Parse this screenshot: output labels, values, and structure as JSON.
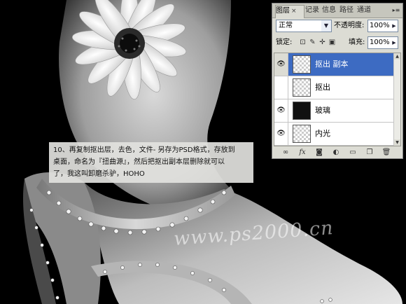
{
  "caption": {
    "lines": [
      "10、再复制抠出层，去色，文件- 另存为PSD格式，存放到",
      "桌面，命名为『扭曲源』，然后把抠出副本层删除就可以",
      "了，我这叫卸磨杀驴，HOHO"
    ]
  },
  "watermark": "www.ps2000.cn",
  "layers_panel": {
    "tabs": [
      {
        "label": "图层",
        "close": "×",
        "active": true
      },
      {
        "label": "记录",
        "active": false
      },
      {
        "label": "信息",
        "active": false
      },
      {
        "label": "路径",
        "active": false
      },
      {
        "label": "通道",
        "active": false
      }
    ],
    "menu_icon": "panel-menu-icon",
    "blend_mode": "正常",
    "opacity_label": "不透明度:",
    "opacity_value": "100%",
    "lock_label": "锁定:",
    "fill_label": "填充:",
    "fill_value": "100%",
    "layers": [
      {
        "name": "抠出 副本",
        "visible": true,
        "selected": true
      },
      {
        "name": "抠出",
        "visible": false,
        "selected": false
      },
      {
        "name": "玻璃",
        "visible": true,
        "selected": false
      },
      {
        "name": "内光",
        "visible": true,
        "selected": false
      }
    ],
    "bottom_icons": [
      "link-icon",
      "fx-icon",
      "mask-icon",
      "adjustment-icon",
      "group-icon",
      "new-layer-icon",
      "trash-icon"
    ],
    "colors": {
      "selected_row": "#3d6bc2",
      "panel_bg": "#dcdcd4"
    }
  }
}
